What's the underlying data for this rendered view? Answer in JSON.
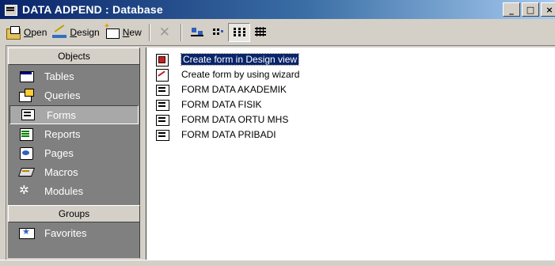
{
  "window": {
    "title": "DATA ADPEND : Database",
    "minimize_glyph": "_",
    "maximize_glyph": "□",
    "close_glyph": "×"
  },
  "toolbar": {
    "open": {
      "accel": "O",
      "rest": "pen"
    },
    "design": {
      "accel": "D",
      "rest": "esign"
    },
    "new": {
      "accel": "N",
      "rest": "ew"
    }
  },
  "objects_bar": {
    "header": "Objects",
    "items": [
      {
        "label": "Tables",
        "icon": "tables-icon"
      },
      {
        "label": "Queries",
        "icon": "queries-icon"
      },
      {
        "label": "Forms",
        "icon": "forms-icon",
        "selected": true
      },
      {
        "label": "Reports",
        "icon": "reports-icon"
      },
      {
        "label": "Pages",
        "icon": "pages-icon"
      },
      {
        "label": "Macros",
        "icon": "macros-icon"
      },
      {
        "label": "Modules",
        "icon": "modules-icon"
      }
    ],
    "groups_header": "Groups",
    "groups": [
      {
        "label": "Favorites",
        "icon": "favorites-icon"
      }
    ]
  },
  "list": {
    "items": [
      {
        "label": "Create form in Design view",
        "icon": "design-view-icon",
        "selected": true
      },
      {
        "label": "Create form by using wizard",
        "icon": "wizard-icon"
      },
      {
        "label": "FORM DATA AKADEMIK",
        "icon": "form-icon"
      },
      {
        "label": "FORM DATA FISIK",
        "icon": "form-icon"
      },
      {
        "label": "FORM DATA ORTU MHS",
        "icon": "form-icon"
      },
      {
        "label": "FORM DATA PRIBADI",
        "icon": "form-icon"
      }
    ]
  },
  "colors": {
    "titlebar_start": "#0a246a",
    "titlebar_end": "#a6caf0",
    "face": "#d4d0c8",
    "objects_bar": "#808080",
    "selection": "#0a246a"
  }
}
